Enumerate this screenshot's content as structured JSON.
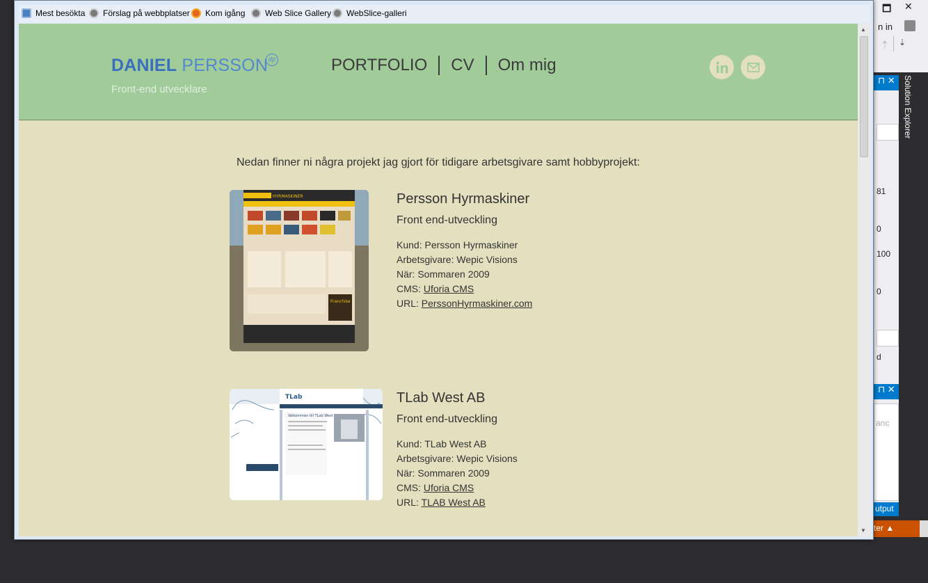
{
  "bookmarks": [
    {
      "label": "Mest besökta",
      "icon": "most-visited-icon"
    },
    {
      "label": "Förslag på webbplatser",
      "icon": "globe-icon"
    },
    {
      "label": "Kom igång",
      "icon": "firefox-icon"
    },
    {
      "label": "Web Slice Gallery",
      "icon": "globe-icon"
    },
    {
      "label": "WebSlice-galleri",
      "icon": "globe-icon"
    }
  ],
  "ide": {
    "signin": "n in",
    "solution_explorer": "Solution Explorer",
    "values": [
      "81",
      "0",
      "100",
      "0"
    ],
    "d_text": "d",
    "faded_text": "anc",
    "output_label": "utput",
    "status_label": "ter ▲"
  },
  "site": {
    "logo_first": "DANIEL",
    "logo_last": "PERSSON",
    "logo_mark": "dp",
    "tagline": "Front-end utvecklare",
    "nav": [
      "PORTFOLIO",
      "CV",
      "Om mig"
    ],
    "social": [
      {
        "icon": "linkedin-icon"
      },
      {
        "icon": "email-icon"
      }
    ],
    "intro": "Nedan finner ni några projekt jag gjort för tidigare arbetsgivare samt hobbyprojekt:"
  },
  "projects": [
    {
      "title": "Persson Hyrmaskiner",
      "subtitle": "Front end-utveckling",
      "client": "Kund: Persson Hyrmaskiner",
      "employer": "Arbetsgivare: Wepic Visions",
      "when": "När: Sommaren 2009",
      "cms_label": "CMS: ",
      "cms_link": "Uforia CMS",
      "url_label": "URL: ",
      "url_link": "PerssonHyrmaskiner.com"
    },
    {
      "title": "TLab West AB",
      "subtitle": "Front end-utveckling",
      "client": "Kund: TLab West AB",
      "employer": "Arbetsgivare: Wepic Visions",
      "when": "När: Sommaren 2009",
      "cms_label": "CMS: ",
      "cms_link": "Uforia CMS",
      "url_label": "URL: ",
      "url_link": "TLAB West AB"
    }
  ],
  "thumb_text": {
    "p1_brand": "HYRMASKINER",
    "p1_franchise": "Franchise",
    "p2_brand": "TLab",
    "p2_welcome": "Välkommen till TLab West"
  },
  "colors": {
    "header_bg": "#a1cc9a",
    "page_bg": "#e3dfbf",
    "logo_blue": "#3b6fbd"
  }
}
